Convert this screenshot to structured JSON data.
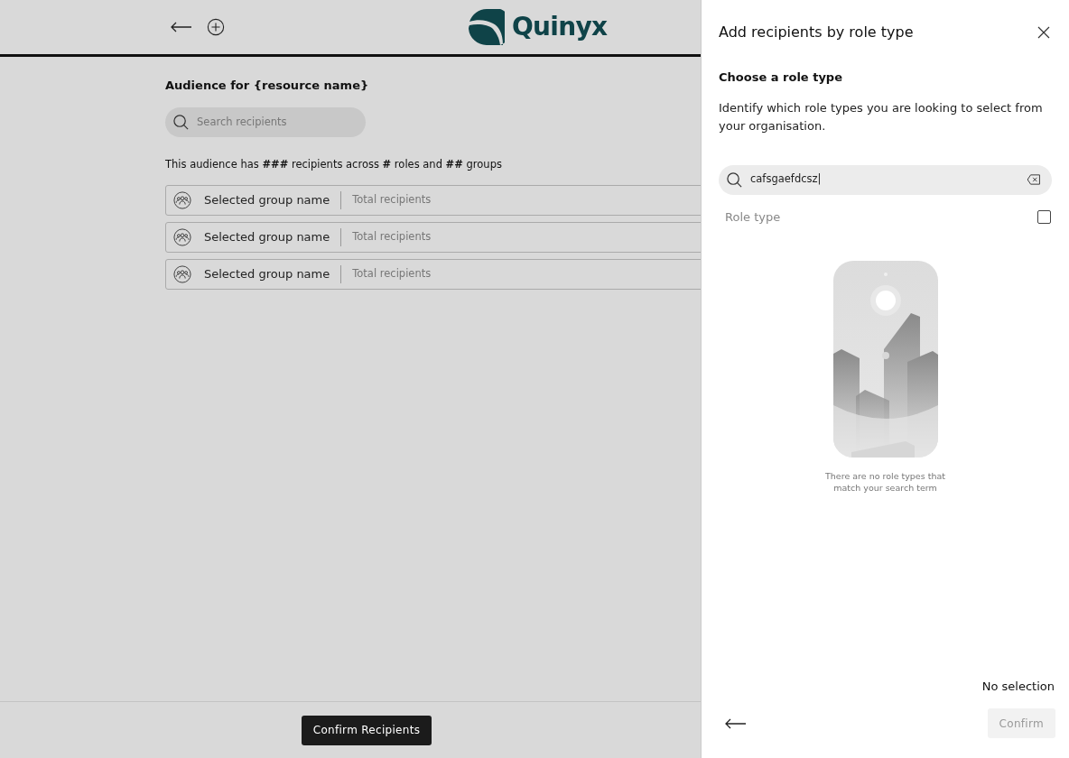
{
  "header": {
    "logo_text": "Quinyx"
  },
  "audience": {
    "title": "Audience for {resource name}",
    "search": {
      "placeholder": "Search recipients"
    },
    "summary": "This audience has **###** recipients across **#** roles and **##** groups",
    "groups": [
      {
        "name": "Selected group name",
        "total": "Total recipients"
      },
      {
        "name": "Selected group name",
        "total": "Total recipients"
      },
      {
        "name": "Selected group name",
        "total": "Total recipients"
      }
    ]
  },
  "footer": {
    "confirm_button": "Confirm Recipients"
  },
  "panel": {
    "title": "Add recipients by role type",
    "subtitle": "Choose a role type",
    "description": "Identify which role types you are looking to select from your organisation.",
    "search": {
      "value": "cafsgaefdcsz|"
    },
    "list_header": {
      "label": "Role type",
      "checked": false
    },
    "empty_message": "There are no role types that match your search term",
    "selection_status": "No selection",
    "confirm": {
      "label": "Confirm",
      "disabled": true
    }
  }
}
